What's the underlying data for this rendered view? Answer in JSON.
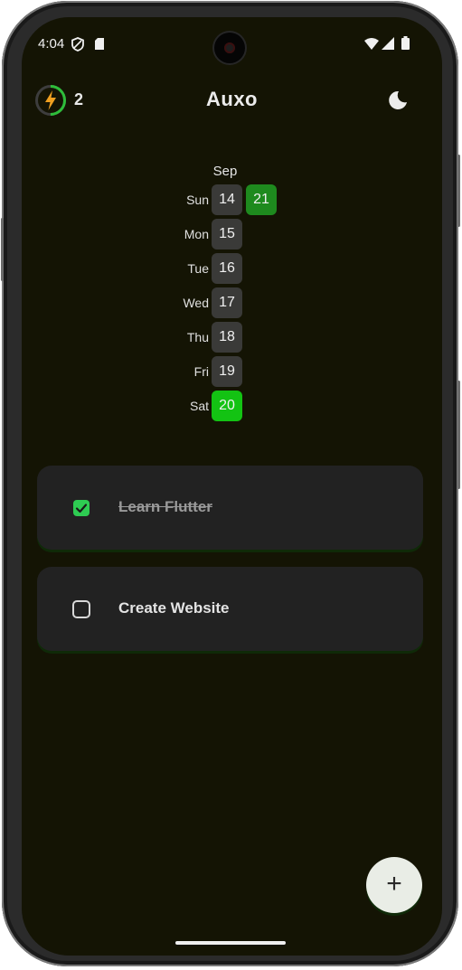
{
  "status_bar": {
    "time": "4:04"
  },
  "app_bar": {
    "title": "Auxo",
    "streak_count": "2",
    "streak_progress": 0.5,
    "icons": {
      "streak": "lightning-bolt-icon",
      "theme": "moon-icon"
    }
  },
  "calendar": {
    "month": "Sep",
    "days": [
      {
        "label": "Sun",
        "dates": [
          {
            "day": "14",
            "status": "none"
          },
          {
            "day": "21",
            "status": "partial"
          }
        ]
      },
      {
        "label": "Mon",
        "dates": [
          {
            "day": "15",
            "status": "none"
          }
        ]
      },
      {
        "label": "Tue",
        "dates": [
          {
            "day": "16",
            "status": "none"
          }
        ]
      },
      {
        "label": "Wed",
        "dates": [
          {
            "day": "17",
            "status": "none"
          }
        ]
      },
      {
        "label": "Thu",
        "dates": [
          {
            "day": "18",
            "status": "none"
          }
        ]
      },
      {
        "label": "Fri",
        "dates": [
          {
            "day": "19",
            "status": "none"
          }
        ]
      },
      {
        "label": "Sat",
        "dates": [
          {
            "day": "20",
            "status": "complete"
          }
        ]
      }
    ]
  },
  "tasks": [
    {
      "title": "Learn Flutter",
      "done": true
    },
    {
      "title": "Create Website",
      "done": false
    }
  ],
  "fab": {
    "label": "+",
    "icon": "plus-icon"
  },
  "colors": {
    "background": "#141404",
    "card": "#222222",
    "cell": "#3a3a38",
    "complete": "#13c313",
    "partial": "#1e8a1e",
    "checked": "#2ecc52",
    "streak_ring": "#2ebd3a",
    "streak_bolt": "#f0a020"
  }
}
